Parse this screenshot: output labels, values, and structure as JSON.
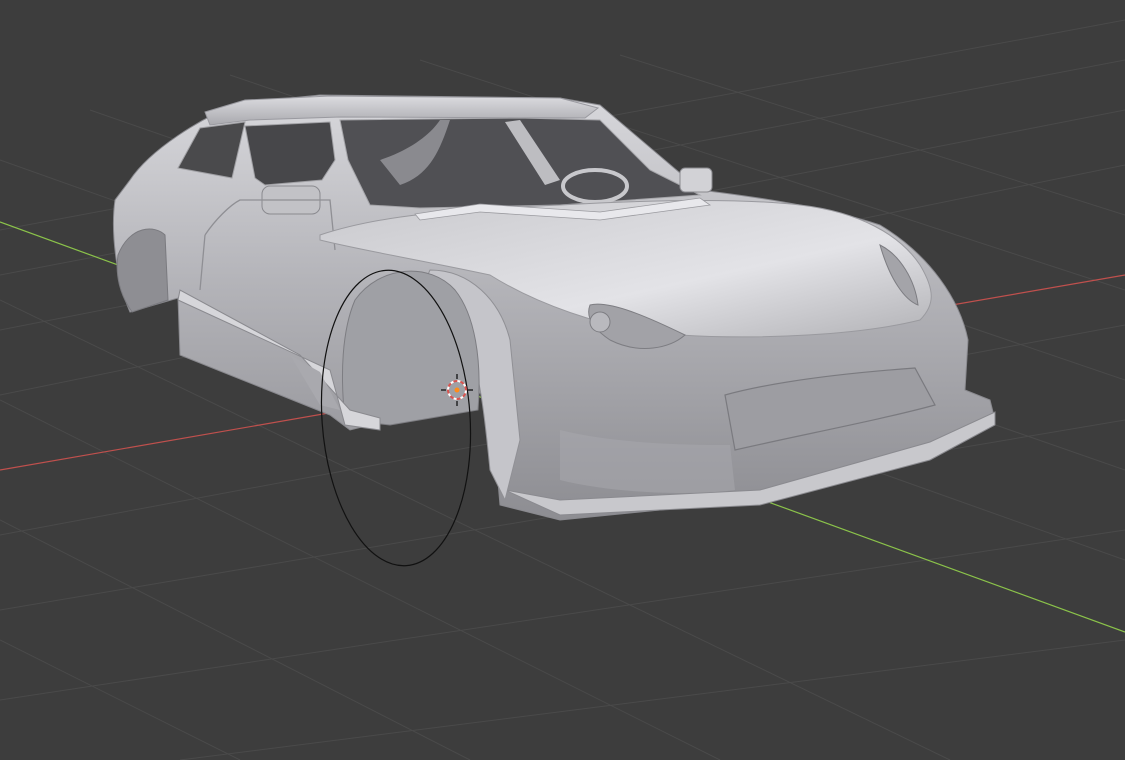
{
  "viewport": {
    "background": "#3d3d3d",
    "grid_color": "#4a4a4a",
    "x_axis_color": "#c0504d",
    "y_axis_color": "#8bc34a",
    "object": "car-body-mesh",
    "object_color": "#b9b9bd",
    "selected_object": "wheel-circle-curve",
    "origin_marker": "3d-cursor-icon"
  }
}
